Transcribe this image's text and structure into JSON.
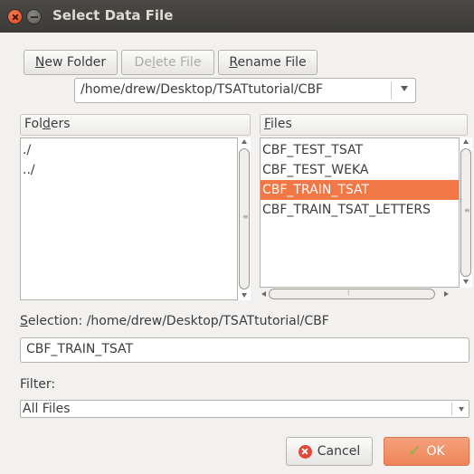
{
  "window": {
    "title": "Select Data File"
  },
  "toolbar": {
    "new_folder": {
      "pre": "",
      "key": "N",
      "post": "ew Folder"
    },
    "delete_file": {
      "pre": "De",
      "key": "l",
      "post": "ete File"
    },
    "rename_file": {
      "pre": "",
      "key": "R",
      "post": "ename File"
    }
  },
  "path_combo": {
    "value": "/home/drew/Desktop/TSATtutorial/CBF"
  },
  "folders": {
    "header": {
      "pre": "Fol",
      "key": "d",
      "post": "ers"
    },
    "items": [
      "./",
      "../"
    ]
  },
  "files": {
    "header": {
      "pre": "",
      "key": "F",
      "post": "iles"
    },
    "items": [
      "CBF_TEST_TSAT",
      "CBF_TEST_WEKA",
      "CBF_TRAIN_TSAT",
      "CBF_TRAIN_TSAT_LETTERS"
    ],
    "selected": "CBF_TRAIN_TSAT"
  },
  "selection": {
    "label_key": "S",
    "label_rest": "election: /home/drew/Desktop/TSATtutorial/CBF",
    "value": "CBF_TRAIN_TSAT"
  },
  "filter": {
    "label": "Filter:",
    "value": "All Files"
  },
  "buttons": {
    "cancel": "Cancel",
    "ok": "OK"
  },
  "colors": {
    "selection": "#f07746",
    "titlebar": "#3c3b37",
    "accent": "#ef8458"
  }
}
